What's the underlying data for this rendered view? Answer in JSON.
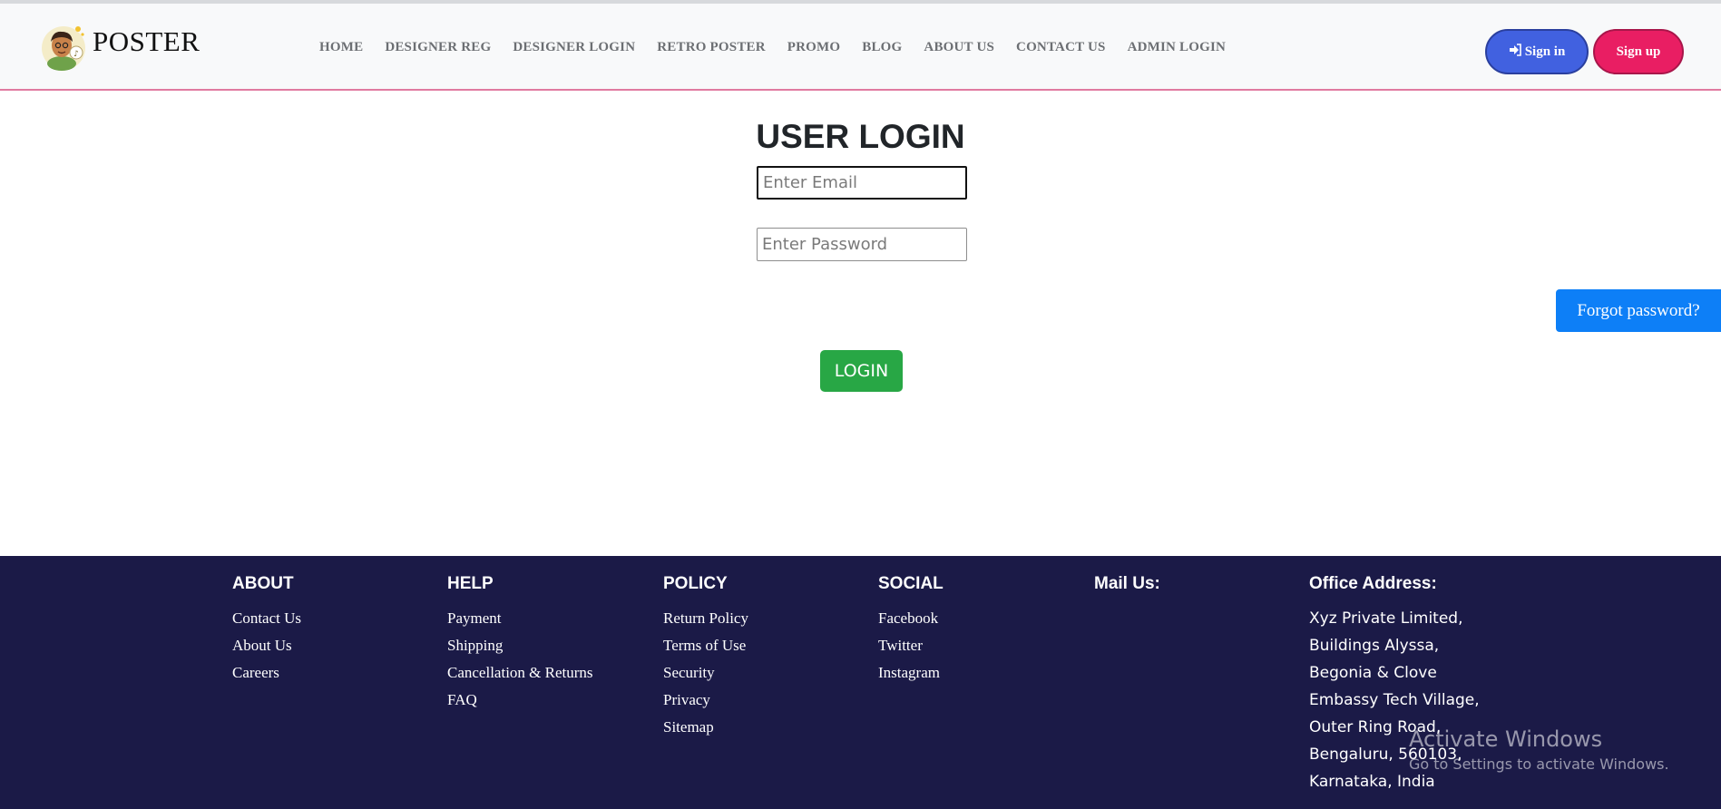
{
  "brand": {
    "name": "POSTER",
    "logo_icon": "poster-boy-logo-icon"
  },
  "nav": {
    "items": [
      "HOME",
      "DESIGNER REG",
      "DESIGNER LOGIN",
      "RETRO POSTER",
      "PROMO",
      "BLOG",
      "ABOUT US",
      "CONTACT US",
      "ADMIN LOGIN"
    ]
  },
  "auth": {
    "signin_label": "Sign in",
    "signin_icon": "sign-in-icon",
    "signup_label": "Sign up",
    "signin_color": "#4161e0",
    "signup_color": "#e91e63"
  },
  "login": {
    "title": "USER LOGIN",
    "email_placeholder": "Enter Email",
    "password_placeholder": "Enter Password",
    "forgot_label": "Forgot password?",
    "login_label": "LOGIN",
    "login_color": "#28a745",
    "forgot_color": "#0d7ff7"
  },
  "footer": {
    "background": "#1b1a47",
    "about": {
      "heading": "ABOUT",
      "links": [
        "Contact Us",
        "About Us",
        "Careers"
      ]
    },
    "help": {
      "heading": "HELP",
      "links": [
        "Payment",
        "Shipping",
        "Cancellation & Returns",
        "FAQ"
      ]
    },
    "policy": {
      "heading": "POLICY",
      "links": [
        "Return Policy",
        "Terms of Use",
        "Security",
        "Privacy",
        "Sitemap"
      ]
    },
    "social": {
      "heading": "SOCIAL",
      "links": [
        "Facebook",
        "Twitter",
        "Instagram"
      ]
    },
    "mail": {
      "heading": "Mail Us:"
    },
    "office": {
      "heading": "Office Address:",
      "lines": [
        "Xyz Private Limited,",
        "Buildings Alyssa,",
        "Begonia & Clove",
        "Embassy Tech Village,",
        "Outer Ring Road,",
        "Bengaluru, 560103,",
        "Karnataka, India"
      ]
    }
  },
  "watermark": {
    "title": "Activate Windows",
    "subtitle": "Go to Settings to activate Windows."
  }
}
